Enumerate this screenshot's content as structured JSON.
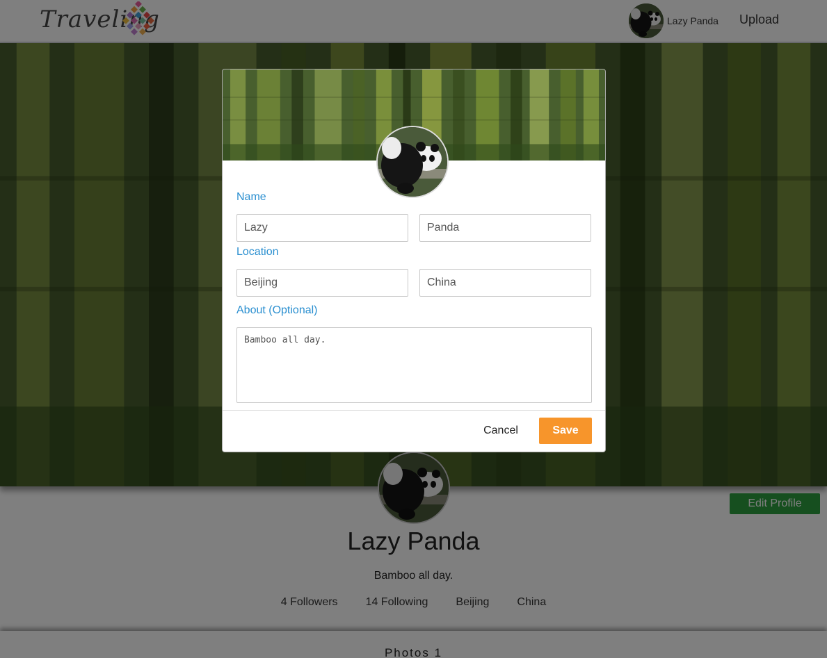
{
  "navbar": {
    "logo_text": "Traveling",
    "user_name": "Lazy Panda",
    "upload_label": "Upload"
  },
  "profile": {
    "name": "Lazy Panda",
    "bio": "Bamboo all day.",
    "edit_profile_label": "Edit Profile",
    "stats": [
      "4 Followers",
      "14 Following",
      "Beijing",
      "China"
    ]
  },
  "photos": {
    "label": "Photos 1"
  },
  "modal": {
    "name_label": "Name",
    "first_name": "Lazy",
    "last_name": "Panda",
    "location_label": "Location",
    "city": "Beijing",
    "country": "China",
    "about_label": "About (Optional)",
    "about": "Bamboo all day.",
    "cancel_label": "Cancel",
    "save_label": "Save"
  },
  "colors": {
    "accent_blue": "#2a8fd0",
    "save_orange": "#f7952b",
    "edit_green": "#2c9e3f"
  }
}
